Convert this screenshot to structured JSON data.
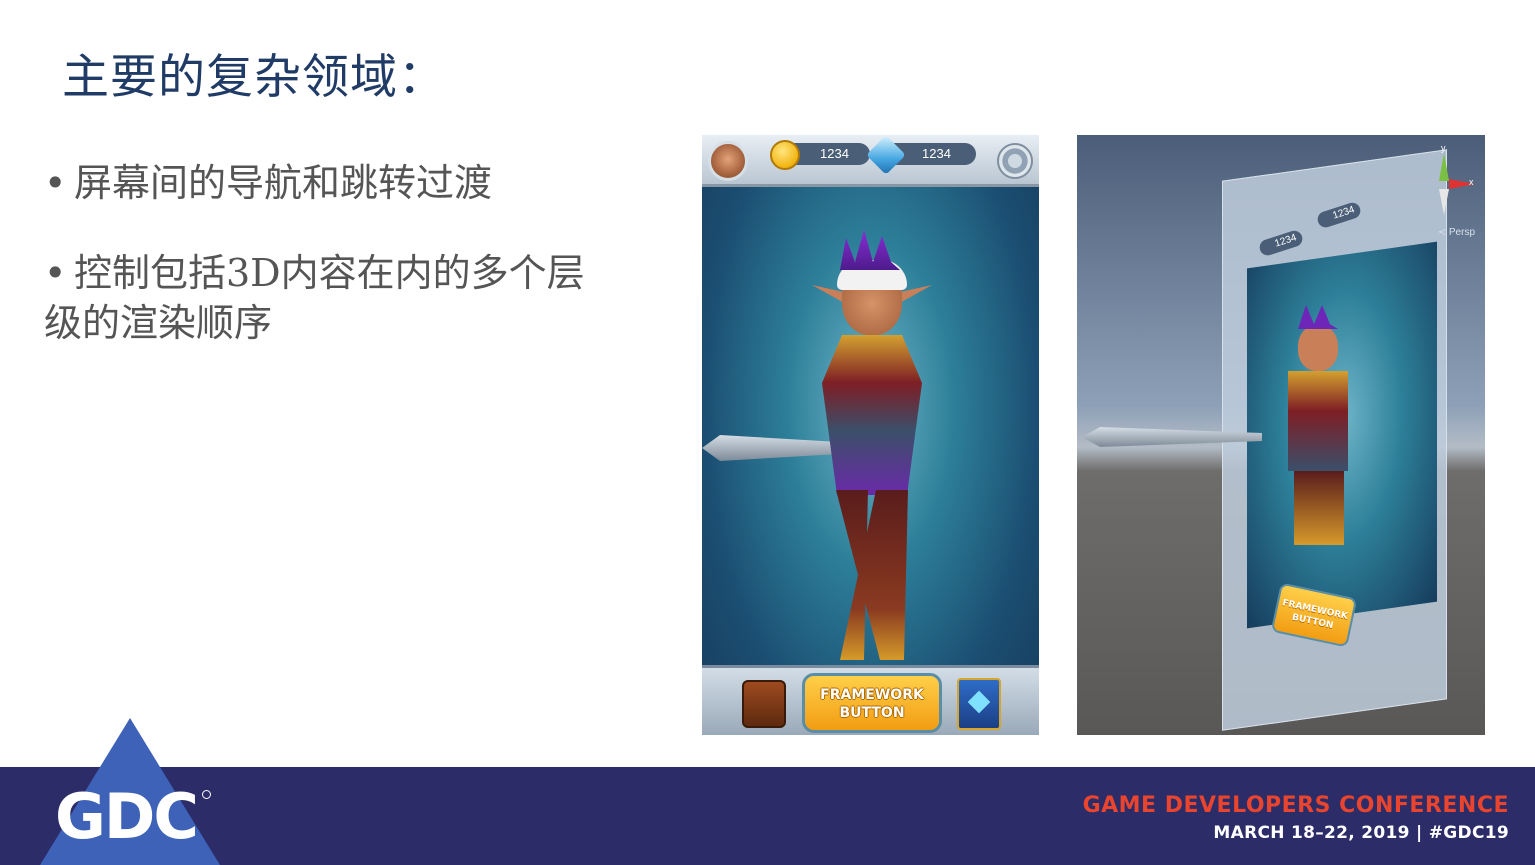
{
  "slide": {
    "title": "主要的复杂领域：",
    "bullets": [
      "屏幕间的导航和跳转过渡",
      "控制包括3D内容在内的多个层级的渲染顺序"
    ],
    "bullet_marker": "•"
  },
  "phone_ui": {
    "coins": "1234",
    "gems": "1234",
    "framework_button": "FRAMEWORK BUTTON"
  },
  "editor_view": {
    "coins": "1234",
    "gems": "1234",
    "framework_button": "FRAMEWORK BUTTON",
    "gizmo_y": "y",
    "gizmo_x": "x",
    "persp_label": "≺ Persp"
  },
  "footer": {
    "logo": "GDC",
    "conference_name": "GAME DEVELOPERS CONFERENCE",
    "conference_dates": "MARCH 18–22, 2019  |  #GDC19",
    "colors": {
      "bar": "#2b2c68",
      "triangle": "#3d62b8",
      "accent": "#e8442e"
    }
  }
}
